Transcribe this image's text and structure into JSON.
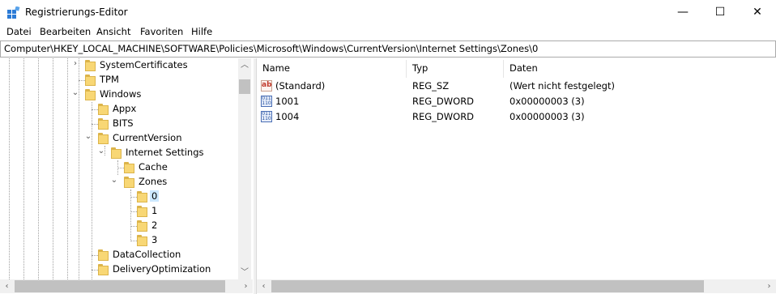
{
  "window": {
    "title": "Registrierungs-Editor",
    "min": "—",
    "max": "☐",
    "close": "✕"
  },
  "menu": [
    "Datei",
    "Bearbeiten",
    "Ansicht",
    "Favoriten",
    "Hilfe"
  ],
  "address": "Computer\\HKEY_LOCAL_MACHINE\\SOFTWARE\\Policies\\Microsoft\\Windows\\CurrentVersion\\Internet Settings\\Zones\\0",
  "tree": [
    {
      "label": "SystemCertificates",
      "toggle": "›"
    },
    {
      "label": "TPM",
      "toggle": ""
    },
    {
      "label": "Windows",
      "toggle": "⌄"
    },
    {
      "label": "Appx",
      "toggle": ""
    },
    {
      "label": "BITS",
      "toggle": ""
    },
    {
      "label": "CurrentVersion",
      "toggle": "⌄"
    },
    {
      "label": "Internet Settings",
      "toggle": "⌄"
    },
    {
      "label": "Cache",
      "toggle": ""
    },
    {
      "label": "Zones",
      "toggle": "⌄"
    },
    {
      "label": "0",
      "toggle": "",
      "selected": true
    },
    {
      "label": "1",
      "toggle": ""
    },
    {
      "label": "2",
      "toggle": ""
    },
    {
      "label": "3",
      "toggle": ""
    },
    {
      "label": "DataCollection",
      "toggle": ""
    },
    {
      "label": "DeliveryOptimization",
      "toggle": ""
    }
  ],
  "columns": {
    "name": "Name",
    "type": "Typ",
    "data": "Daten"
  },
  "values": [
    {
      "icon": "string-value-icon",
      "name": "(Standard)",
      "type": "REG_SZ",
      "data": "(Wert nicht festgelegt)"
    },
    {
      "icon": "dword-value-icon",
      "name": "1001",
      "type": "REG_DWORD",
      "data": "0x00000003 (3)"
    },
    {
      "icon": "dword-value-icon",
      "name": "1004",
      "type": "REG_DWORD",
      "data": "0x00000003 (3)"
    }
  ],
  "colors": {
    "selection": "#cce8ff",
    "folder": "#f8d775",
    "scrollbar": "#f0f0f0"
  }
}
